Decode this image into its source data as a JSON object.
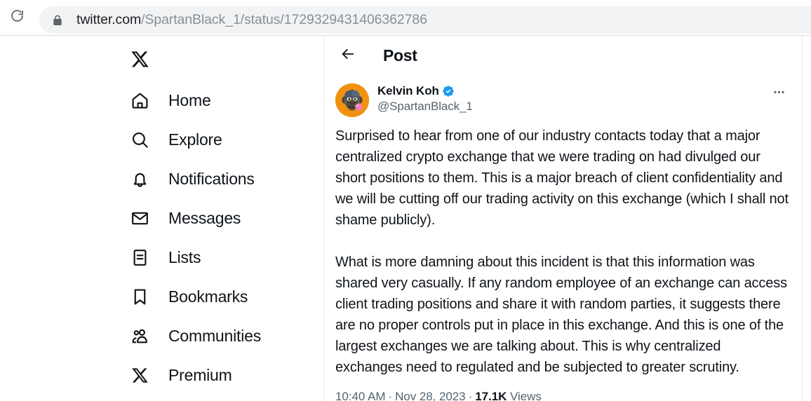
{
  "browser": {
    "reload_icon": "reload-icon",
    "lock_icon": "lock-icon",
    "url_host": "twitter.com",
    "url_path": "/SpartanBlack_1/status/1729329431406362786",
    "url_full": "twitter.com/SpartanBlack_1/status/1729329431406362786"
  },
  "sidebar": {
    "logo": "x-logo",
    "items": [
      {
        "label": "Home",
        "icon": "home-icon"
      },
      {
        "label": "Explore",
        "icon": "search-icon"
      },
      {
        "label": "Notifications",
        "icon": "bell-icon"
      },
      {
        "label": "Messages",
        "icon": "envelope-icon"
      },
      {
        "label": "Lists",
        "icon": "lists-icon"
      },
      {
        "label": "Bookmarks",
        "icon": "bookmark-icon"
      },
      {
        "label": "Communities",
        "icon": "communities-icon"
      },
      {
        "label": "Premium",
        "icon": "x-logo-icon"
      }
    ]
  },
  "main": {
    "header": {
      "back_icon": "back-arrow-icon",
      "title": "Post"
    },
    "post": {
      "avatar_alt": "bored-ape-avatar",
      "display_name": "Kelvin Koh",
      "verified_icon": "verified-badge-icon",
      "handle": "@SpartanBlack_1",
      "more_icon": "more-options-icon",
      "paragraphs": [
        "Surprised to hear from one of our industry contacts today that a major centralized crypto exchange that we were trading on had divulged our short positions to them. This is a major breach of client confidentiality and we will be cutting off our trading activity on this exchange (which I shall not shame publicly).",
        "What is more damning about this incident is that this information was shared very casually. If any random employee of an exchange can access client trading positions and share it with random parties, it suggests there are no proper controls put in place in this exchange. And this is one of the largest exchanges we are talking about. This is why centralized exchanges need to regulated and be subjected to greater scrutiny."
      ],
      "time": "10:40 AM",
      "date": "Nov 28, 2023",
      "views_count": "17.1K",
      "views_label": "Views",
      "separator": "·"
    }
  },
  "colors": {
    "verified_blue": "#1d9bf0",
    "text_primary": "#0f1419",
    "text_secondary": "#536471",
    "avatar_background": "#f0920f",
    "divider": "#e6e7e8"
  }
}
